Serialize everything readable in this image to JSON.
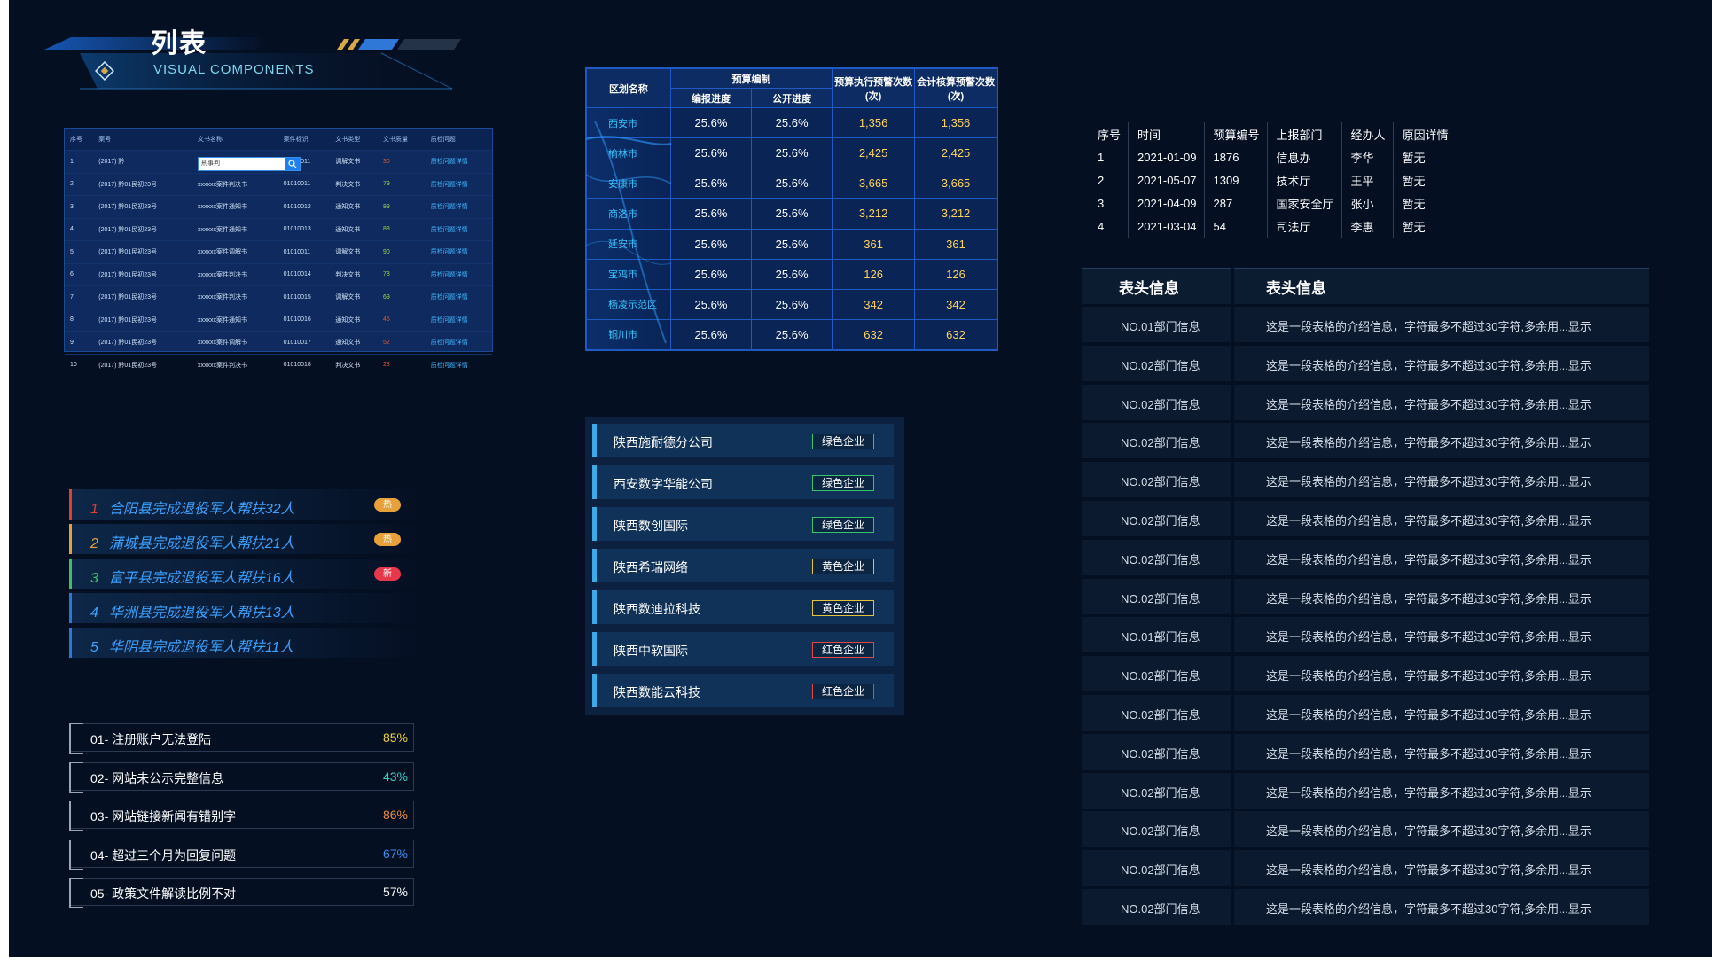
{
  "title": {
    "cn": "列表",
    "en": "VISUAL COMPONENTS"
  },
  "doc_table": {
    "headers": [
      "序号",
      "案号",
      "文书名称",
      "案件标识",
      "文书类型",
      "文书质量",
      "质检问题"
    ],
    "search_value": "刑事判",
    "rows": [
      {
        "no": "1",
        "case": "(2017) 黔",
        "name": "",
        "id": "01010011",
        "type": "调解文书",
        "q": "30",
        "issue": "质检问题详情"
      },
      {
        "no": "2",
        "case": "(2017) 黔01民初23号",
        "name": "xxxxxx案件判决书",
        "id": "01010011",
        "type": "判决文书",
        "q": "79",
        "issue": "质检问题详情"
      },
      {
        "no": "3",
        "case": "(2017) 黔01民初23号",
        "name": "xxxxxx案件通知书",
        "id": "01010012",
        "type": "通知文书",
        "q": "89",
        "issue": "质检问题详情"
      },
      {
        "no": "4",
        "case": "(2017) 黔01民初23号",
        "name": "xxxxxx案件通知书",
        "id": "01010013",
        "type": "通知文书",
        "q": "88",
        "issue": "质检问题详情"
      },
      {
        "no": "5",
        "case": "(2017) 黔01民初23号",
        "name": "xxxxxx案件调解书",
        "id": "01010011",
        "type": "调解文书",
        "q": "90",
        "issue": "质检问题详情"
      },
      {
        "no": "6",
        "case": "(2017) 黔01民初23号",
        "name": "xxxxxx案件判决书",
        "id": "01010014",
        "type": "判决文书",
        "q": "78",
        "issue": "质检问题详情"
      },
      {
        "no": "7",
        "case": "(2017) 黔01民初23号",
        "name": "xxxxxx案件判决书",
        "id": "01010015",
        "type": "调解文书",
        "q": "69",
        "issue": "质检问题详情"
      },
      {
        "no": "8",
        "case": "(2017) 黔01民初23号",
        "name": "xxxxxx案件通知书",
        "id": "01010016",
        "type": "通知文书",
        "q": "45",
        "issue": "质检问题详情"
      },
      {
        "no": "9",
        "case": "(2017) 黔01民初23号",
        "name": "xxxxxx案件调解书",
        "id": "01010017",
        "type": "通知文书",
        "q": "52",
        "issue": "质检问题详情"
      },
      {
        "no": "10",
        "case": "(2017) 黔01民初23号",
        "name": "xxxxxx案件判决书",
        "id": "01010018",
        "type": "判决文书",
        "q": "23",
        "issue": "质检问题详情"
      }
    ]
  },
  "budget": {
    "h_region": "区划名称",
    "h_group": "预算编制",
    "h_sub1": "编报进度",
    "h_sub2": "公开进度",
    "h_exec": "预算执行预警次数 (次)",
    "h_audit": "会计核算预警次数 (次)",
    "rows": [
      {
        "city": "西安市",
        "p1": "25.6%",
        "p2": "25.6%",
        "e": "1,356",
        "a": "1,356"
      },
      {
        "city": "榆林市",
        "p1": "25.6%",
        "p2": "25.6%",
        "e": "2,425",
        "a": "2,425"
      },
      {
        "city": "安康市",
        "p1": "25.6%",
        "p2": "25.6%",
        "e": "3,665",
        "a": "3,665"
      },
      {
        "city": "商洛市",
        "p1": "25.6%",
        "p2": "25.6%",
        "e": "3,212",
        "a": "3,212"
      },
      {
        "city": "延安市",
        "p1": "25.6%",
        "p2": "25.6%",
        "e": "361",
        "a": "361"
      },
      {
        "city": "宝鸡市",
        "p1": "25.6%",
        "p2": "25.6%",
        "e": "126",
        "a": "126"
      },
      {
        "city": "杨凌示范区",
        "p1": "25.6%",
        "p2": "25.6%",
        "e": "342",
        "a": "342"
      },
      {
        "city": "铜川市",
        "p1": "25.6%",
        "p2": "25.6%",
        "e": "632",
        "a": "632"
      }
    ]
  },
  "simple_table": {
    "headers": [
      "序号",
      "时间",
      "预算编号",
      "上报部门",
      "经办人",
      "原因详情"
    ],
    "rows": [
      [
        "1",
        "2021-01-09",
        "1876",
        "信息办",
        "李华",
        "暂无"
      ],
      [
        "2",
        "2021-05-07",
        "1309",
        "技术厅",
        "王平",
        "暂无"
      ],
      [
        "3",
        "2021-04-09",
        "287",
        "国家安全厅",
        "张小",
        "暂无"
      ],
      [
        "4",
        "2021-03-04",
        "54",
        "司法厅",
        "李惠",
        "暂无"
      ]
    ]
  },
  "ranking": [
    {
      "n": "1",
      "text": "合阳县完成退役军人帮扶32人",
      "tag": "热",
      "bar": "#e0412f",
      "tag_color": "#e8a13a"
    },
    {
      "n": "2",
      "text": "蒲城县完成退役军人帮扶21人",
      "tag": "热",
      "bar": "#e8a13a",
      "tag_color": "#e8a13a"
    },
    {
      "n": "3",
      "text": "富平县完成退役军人帮扶16人",
      "tag": "新",
      "bar": "#3fbf63",
      "tag_color": "#e5394b"
    },
    {
      "n": "4",
      "text": "华洲县完成退役军人帮扶13人",
      "tag": "",
      "bar": "#2b77d4",
      "tag_color": ""
    },
    {
      "n": "5",
      "text": "华阴县完成退役军人帮扶11人",
      "tag": "",
      "bar": "#2b77d4",
      "tag_color": ""
    }
  ],
  "issues": [
    {
      "label": "01- 注册账户无法登陆",
      "pct": "85%",
      "color": "#f2d23a"
    },
    {
      "label": "02- 网站未公示完整信息",
      "pct": "43%",
      "color": "#35d0c6"
    },
    {
      "label": "03- 网站链接新闻有错别字",
      "pct": "86%",
      "color": "#f08a3a"
    },
    {
      "label": "04- 超过三个月为回复问题",
      "pct": "67%",
      "color": "#3b8df2"
    },
    {
      "label": "05- 政策文件解读比例不对",
      "pct": "57%",
      "color": "#ffffff"
    }
  ],
  "enterprises": [
    {
      "name": "陕西施耐德分公司",
      "badge": "绿色企业",
      "color": "#36c46b"
    },
    {
      "name": "西安数字华能公司",
      "badge": "绿色企业",
      "color": "#36c46b"
    },
    {
      "name": "陕西数创国际",
      "badge": "绿色企业",
      "color": "#36c46b"
    },
    {
      "name": "陕西希瑞网络",
      "badge": "黄色企业",
      "color": "#e5c23a"
    },
    {
      "name": "陕西数迪拉科技",
      "badge": "黄色企业",
      "color": "#e5c23a"
    },
    {
      "name": "陕西中软国际",
      "badge": "红色企业",
      "color": "#e04646"
    },
    {
      "name": "陕西数能云科技",
      "badge": "红色企业",
      "color": "#e04646"
    }
  ],
  "info_table": {
    "h1": "表头信息",
    "h2": "表头信息",
    "rows": [
      {
        "dept": "NO.01部门信息",
        "desc": "这是一段表格的介绍信息，字符最多不超过30字符,多余用...显示"
      },
      {
        "dept": "NO.02部门信息",
        "desc": "这是一段表格的介绍信息，字符最多不超过30字符,多余用...显示"
      },
      {
        "dept": "NO.02部门信息",
        "desc": "这是一段表格的介绍信息，字符最多不超过30字符,多余用...显示"
      },
      {
        "dept": "NO.02部门信息",
        "desc": "这是一段表格的介绍信息，字符最多不超过30字符,多余用...显示"
      },
      {
        "dept": "NO.02部门信息",
        "desc": "这是一段表格的介绍信息，字符最多不超过30字符,多余用...显示"
      },
      {
        "dept": "NO.02部门信息",
        "desc": "这是一段表格的介绍信息，字符最多不超过30字符,多余用...显示"
      },
      {
        "dept": "NO.02部门信息",
        "desc": "这是一段表格的介绍信息，字符最多不超过30字符,多余用...显示"
      },
      {
        "dept": "NO.02部门信息",
        "desc": "这是一段表格的介绍信息，字符最多不超过30字符,多余用...显示"
      },
      {
        "dept": "NO.01部门信息",
        "desc": "这是一段表格的介绍信息，字符最多不超过30字符,多余用...显示"
      },
      {
        "dept": "NO.02部门信息",
        "desc": "这是一段表格的介绍信息，字符最多不超过30字符,多余用...显示"
      },
      {
        "dept": "NO.02部门信息",
        "desc": "这是一段表格的介绍信息，字符最多不超过30字符,多余用...显示"
      },
      {
        "dept": "NO.02部门信息",
        "desc": "这是一段表格的介绍信息，字符最多不超过30字符,多余用...显示"
      },
      {
        "dept": "NO.02部门信息",
        "desc": "这是一段表格的介绍信息，字符最多不超过30字符,多余用...显示"
      },
      {
        "dept": "NO.02部门信息",
        "desc": "这是一段表格的介绍信息，字符最多不超过30字符,多余用...显示"
      },
      {
        "dept": "NO.02部门信息",
        "desc": "这是一段表格的介绍信息，字符最多不超过30字符,多余用...显示"
      },
      {
        "dept": "NO.02部门信息",
        "desc": "这是一段表格的介绍信息，字符最多不超过30字符,多余用...显示"
      }
    ]
  }
}
